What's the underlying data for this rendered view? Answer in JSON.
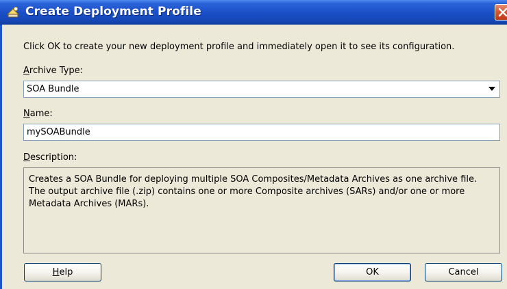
{
  "window": {
    "title": "Create Deployment Profile",
    "icon": "deployment-wizard-icon",
    "title_bar_color": "#1a4ec7",
    "close_color": "#d8562f"
  },
  "instruction": "Click OK to create your new deployment profile and immediately open it to see its configuration.",
  "archive_type": {
    "label_mnemonic": "A",
    "label_rest": "rchive Type:",
    "selected": "SOA Bundle"
  },
  "name": {
    "label_mnemonic": "N",
    "label_rest": "ame:",
    "value": "mySOABundle"
  },
  "description": {
    "label_mnemonic": "D",
    "label_rest": "escription:",
    "text": "Creates a SOA Bundle for deploying multiple SOA Composites/Metadata Archives as one archive file. The output archive file (.zip) contains one or more Composite archives (SARs) and/or one or more Metadata Archives (MARs)."
  },
  "buttons": {
    "help_mnemonic": "H",
    "help_rest": "elp",
    "ok": "OK",
    "cancel": "Cancel"
  }
}
